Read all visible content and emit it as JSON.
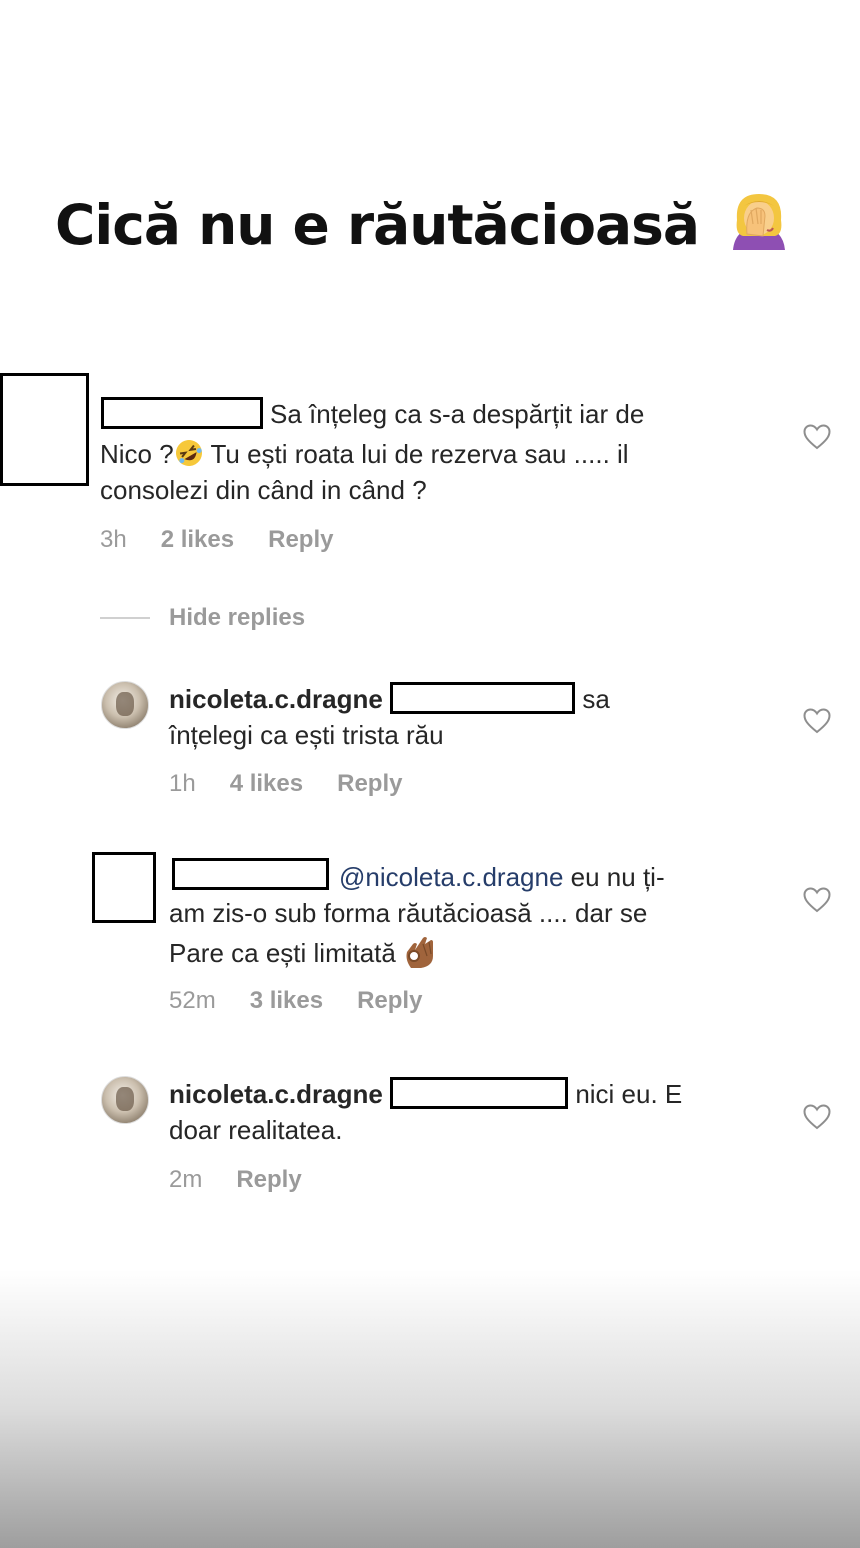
{
  "story": {
    "title": "Cică nu e răutăcioasă",
    "title_emoji_icon": "woman-facepalming-icon"
  },
  "comments": {
    "c1": {
      "text_part1": "Sa înțeleg ca s-a despărțit iar de",
      "text_part2": "Nico ?",
      "text_part3": "Tu ești roata lui de rezerva sau ..... il",
      "text_part4": "consolezi din când in când ?",
      "emoji_icon": "rolling-on-floor-laughing-icon",
      "time": "3h",
      "likes": "2 likes",
      "reply": "Reply"
    },
    "hide_replies": "Hide replies",
    "r1": {
      "username": "nicoleta.c.dragne",
      "text_part1": "sa",
      "text_part2": "înțelegi ca ești trista rău",
      "time": "1h",
      "likes": "4 likes",
      "reply": "Reply"
    },
    "r2": {
      "mention": "@nicoleta.c.dragne",
      "text_part1": "eu nu ți-",
      "text_part2": "am zis-o sub forma răutăcioasă .... dar se",
      "text_part3": "Pare ca ești limitată",
      "emoji_icon": "ok-hand-icon",
      "time": "52m",
      "likes": "3 likes",
      "reply": "Reply"
    },
    "r3": {
      "username": "nicoleta.c.dragne",
      "text_part1": "nici eu. E",
      "text_part2": "doar realitatea.",
      "time": "2m",
      "reply": "Reply"
    }
  },
  "colors": {
    "text": "#262626",
    "meta": "#9a9a9a",
    "mention": "#263d6a"
  }
}
